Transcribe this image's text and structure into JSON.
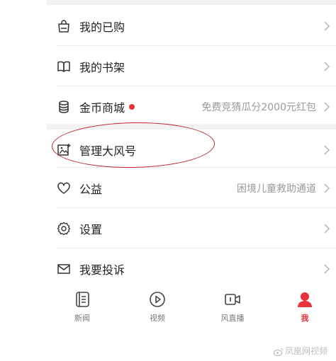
{
  "menu": {
    "items": [
      {
        "label": "我的已购",
        "sub": "",
        "icon": "shopping-bag-icon"
      },
      {
        "label": "我的书架",
        "sub": "",
        "icon": "book-icon"
      },
      {
        "label": "金币商城",
        "sub": "免费竞猜瓜分2000元红包",
        "icon": "coin-stack-icon"
      },
      {
        "label": "管理大风号",
        "sub": "",
        "icon": "image-edit-icon"
      },
      {
        "label": "公益",
        "sub": "困境儿童救助通道",
        "icon": "heart-icon"
      },
      {
        "label": "设置",
        "sub": "",
        "icon": "gear-icon"
      },
      {
        "label": "我要投诉",
        "sub": "",
        "icon": "mail-icon"
      }
    ]
  },
  "tabbar": {
    "tabs": [
      {
        "label": "新闻",
        "icon": "news-icon"
      },
      {
        "label": "视频",
        "icon": "play-icon"
      },
      {
        "label": "风直播",
        "icon": "live-camera-icon"
      },
      {
        "label": "我",
        "icon": "user-icon"
      }
    ],
    "active_index": 3
  },
  "watermark": {
    "text": "凤凰网视频"
  },
  "colors": {
    "accent": "#e8323c",
    "highlight_oval": "#c0262d",
    "muted": "#9a9a9a"
  }
}
